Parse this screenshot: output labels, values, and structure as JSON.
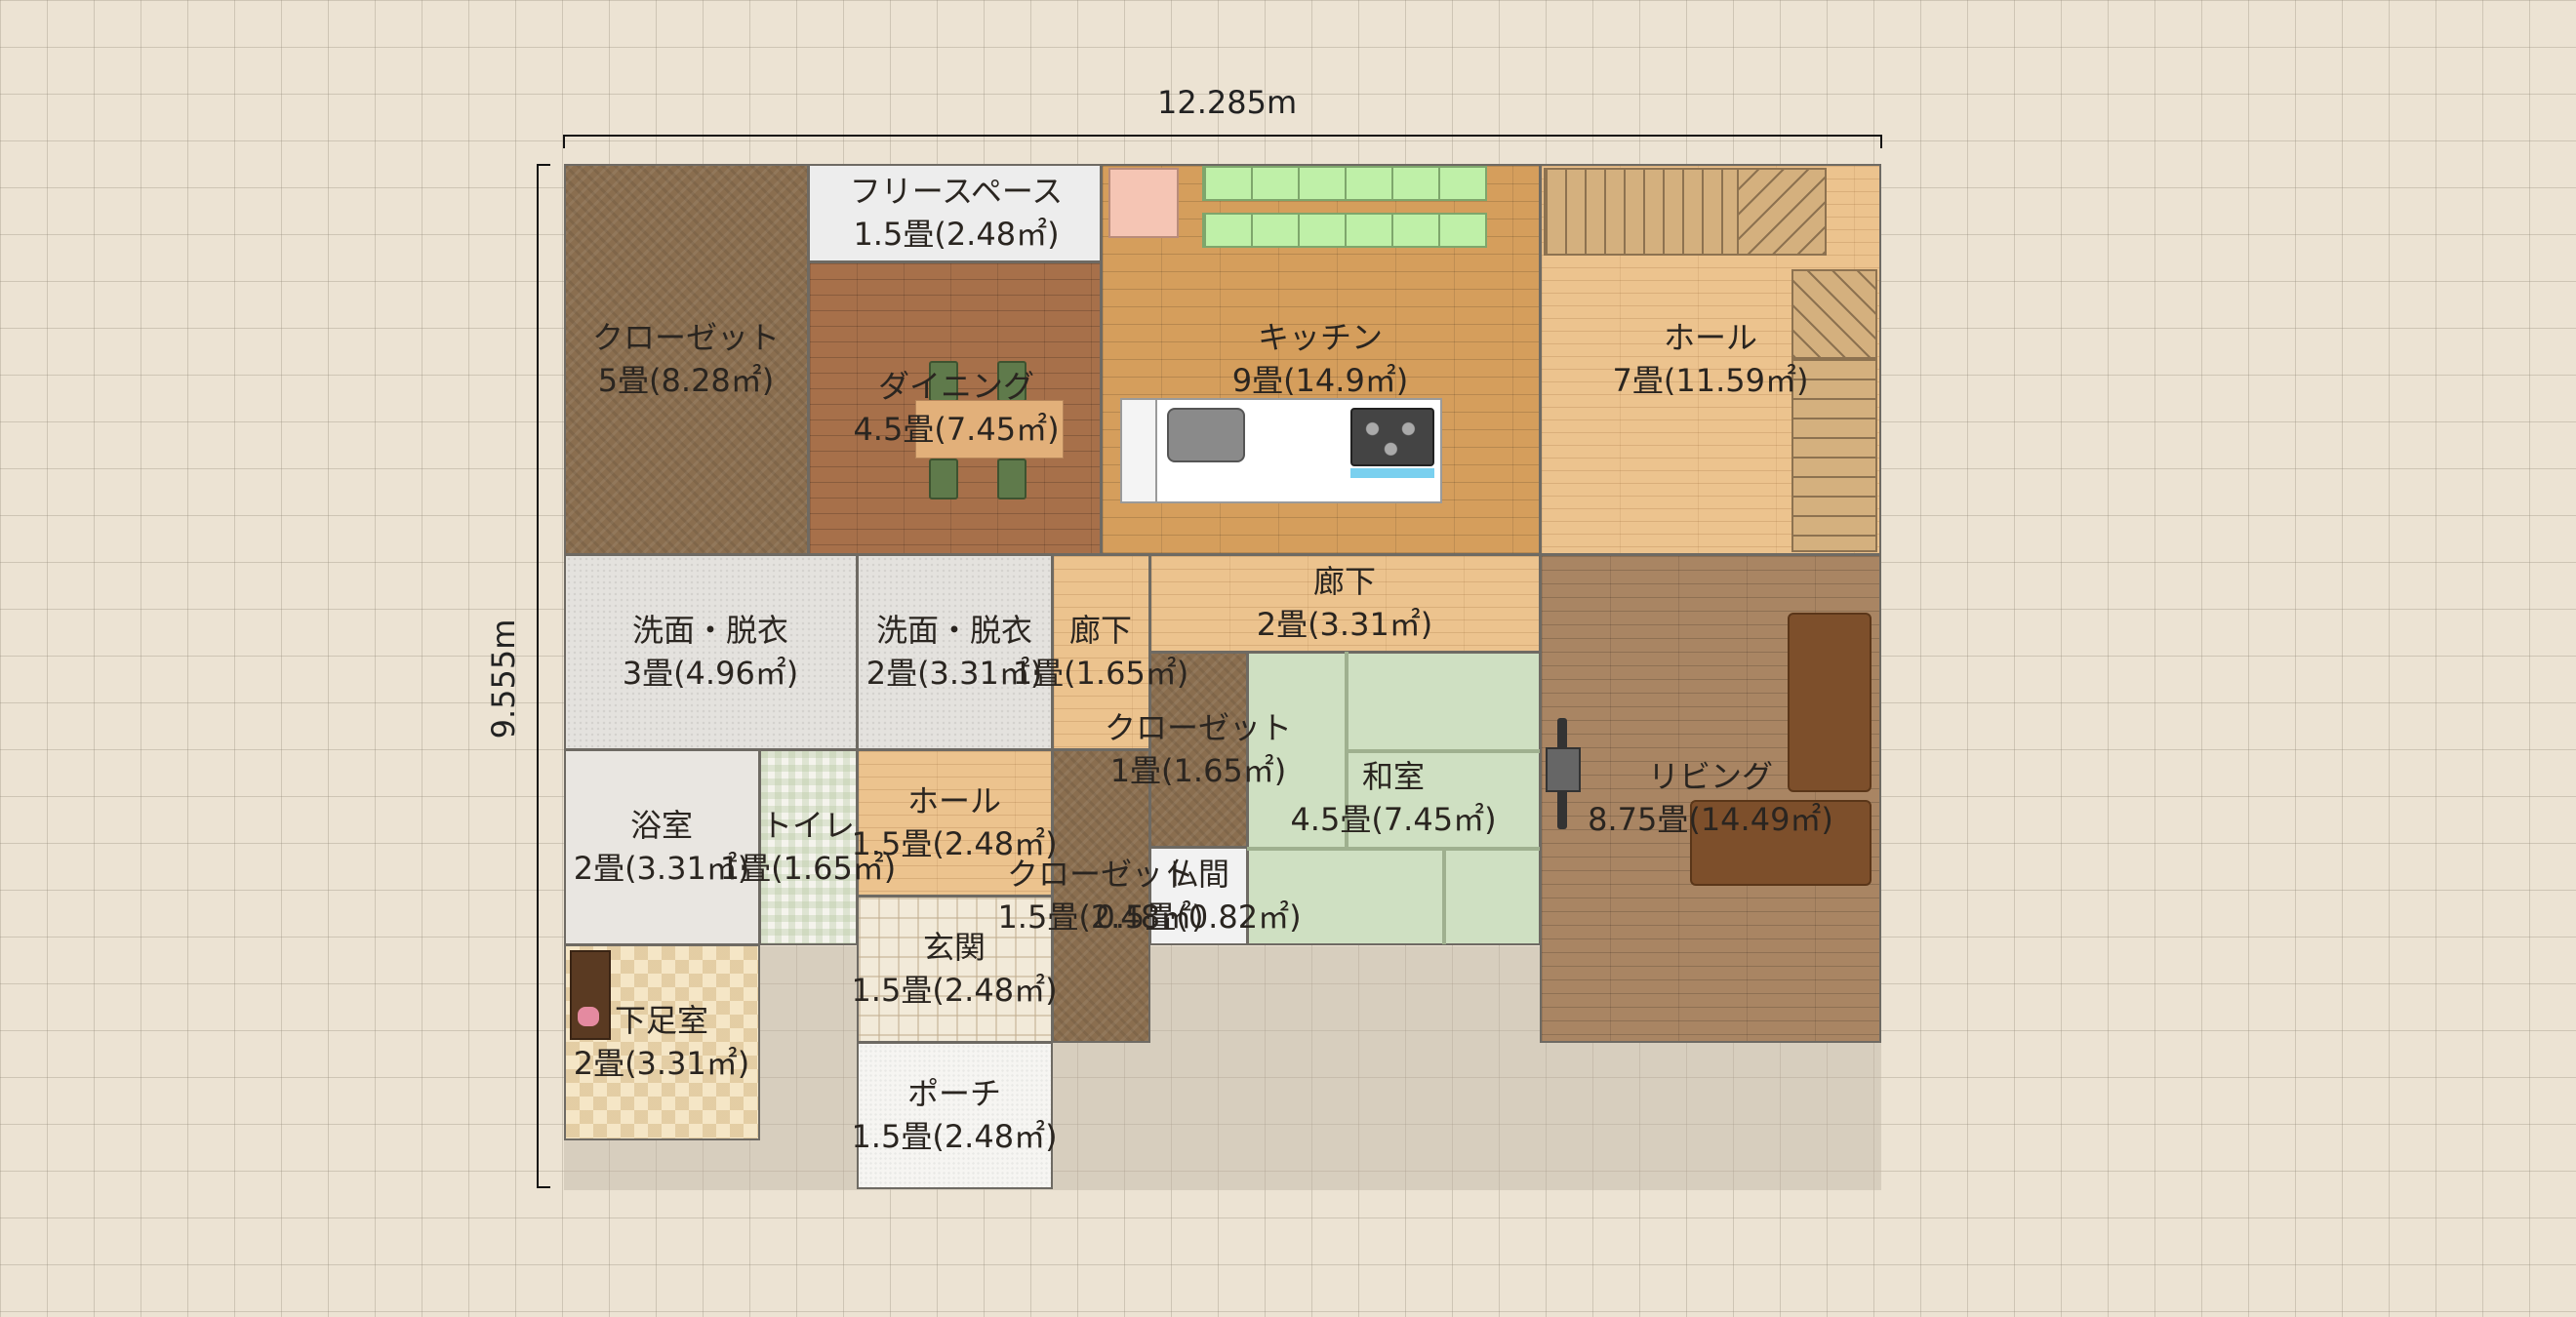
{
  "dimensions": {
    "width": "12.285m",
    "height": "9.555m"
  },
  "rooms": {
    "closet_main": {
      "name": "クローゼット",
      "size": "5畳(8.28㎡)"
    },
    "free_space": {
      "name": "フリースペース",
      "size": "1.5畳(2.48㎡)"
    },
    "dining": {
      "name": "ダイニング",
      "size": "4.5畳(7.45㎡)"
    },
    "kitchen": {
      "name": "キッチン",
      "size": "9畳(14.9㎡)"
    },
    "hall_upper": {
      "name": "ホール",
      "size": "7畳(11.59㎡)"
    },
    "washroom_1": {
      "name": "洗面・脱衣",
      "size": "3畳(4.96㎡)"
    },
    "washroom_2": {
      "name": "洗面・脱衣",
      "size": "2畳(3.31㎡)"
    },
    "corridor_small": {
      "name": "廊下",
      "size": "1畳(1.65㎡)"
    },
    "corridor_main": {
      "name": "廊下",
      "size": "2畳(3.31㎡)"
    },
    "closet_small": {
      "name": "クローゼット",
      "size": "1畳(1.65㎡)"
    },
    "washitsu": {
      "name": "和室",
      "size": "4.5畳(7.45㎡)"
    },
    "living": {
      "name": "リビング",
      "size": "8.75畳(14.49㎡)"
    },
    "bathroom": {
      "name": "浴室",
      "size": "2畳(3.31㎡)"
    },
    "toilet": {
      "name": "トイレ",
      "size": "1畳(1.65㎡)"
    },
    "hall_lower": {
      "name": "ホール",
      "size": "1.5畳(2.48㎡)"
    },
    "closet_lower": {
      "name": "クローゼット",
      "size": "1.5畳(2.48㎡)"
    },
    "butsuma": {
      "name": "仏間",
      "size": "0.5畳(0.82㎡)"
    },
    "shoe_room": {
      "name": "下足室",
      "size": "2畳(3.31㎡)"
    },
    "genkan": {
      "name": "玄関",
      "size": "1.5畳(2.48㎡)"
    },
    "porch": {
      "name": "ポーチ",
      "size": "1.5畳(2.48㎡)"
    }
  },
  "colors": {
    "background": "#ece3d3",
    "wall": "#6e6a63",
    "label": "#2a2520",
    "closet": "#8a6e4f",
    "tatami": "#cfe0c2"
  },
  "icons": [
    "dining-table-icon",
    "dining-chair-icon",
    "kitchen-counter-icon",
    "sink-icon",
    "stove-icon",
    "refrigerator-icon",
    "cupboard-icon",
    "staircase-icon",
    "sofa-icon",
    "tv-icon",
    "shoe-cabinet-icon",
    "slippers-icon"
  ]
}
